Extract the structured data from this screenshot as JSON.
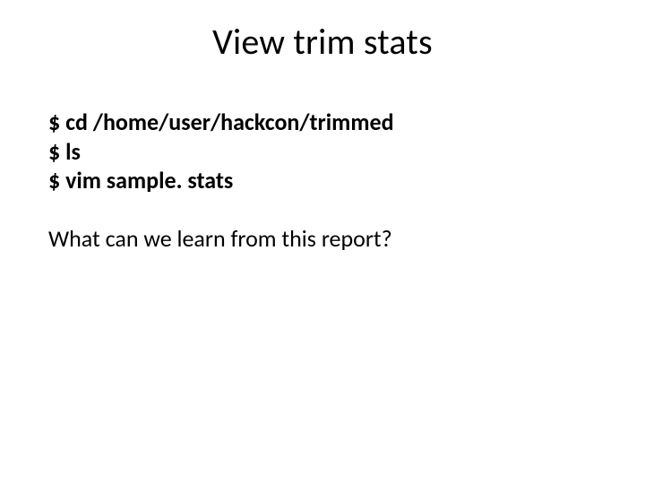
{
  "title": "View trim stats",
  "commands": {
    "line1_prompt": "$ ",
    "line1_cmd": "cd /home/user/hackcon/trimmed",
    "line2_prompt": "$ ",
    "line2_cmd": "ls",
    "line3_prompt": "$ ",
    "line3_cmd": "vim sample. stats"
  },
  "question": "What can we learn from this report?"
}
